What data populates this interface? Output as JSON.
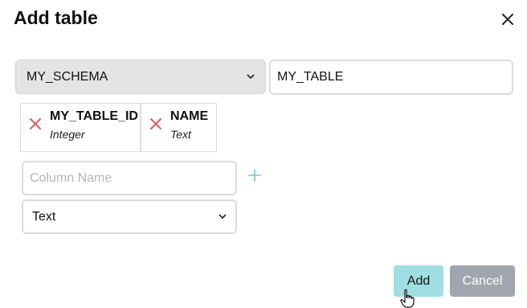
{
  "dialog": {
    "title": "Add table"
  },
  "icons": {
    "close": "close-icon",
    "remove": "x-icon",
    "add": "plus-icon",
    "dropdown": "chevron-down-icon",
    "cursor": "hand-pointer-cursor"
  },
  "colors": {
    "remove_icon": "#e05a5a",
    "plus_icon": "#7fd0d3",
    "add_button": "#9edfe2",
    "cancel_button": "#a1a6ae"
  },
  "form": {
    "schema_select": {
      "selected": "MY_SCHEMA"
    },
    "table_name": {
      "value": "MY_TABLE"
    },
    "columns": [
      {
        "name": "MY_TABLE_ID",
        "type": "Integer"
      },
      {
        "name": "NAME",
        "type": "Text"
      }
    ],
    "new_column": {
      "name_placeholder": "Column Name",
      "type_selected": "Text"
    }
  },
  "actions": {
    "add_label": "Add",
    "cancel_label": "Cancel"
  }
}
